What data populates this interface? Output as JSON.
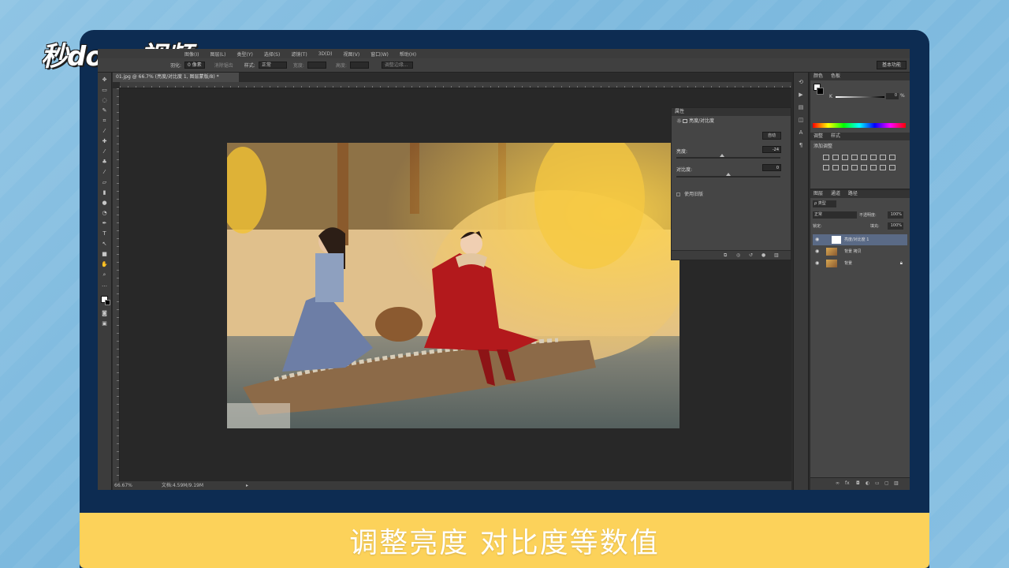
{
  "logo": {
    "text": "秒dong视频"
  },
  "caption": {
    "text": "调整亮度 对比度等数值"
  },
  "menubar": {
    "items": [
      "图像(I)",
      "图层(L)",
      "类型(Y)",
      "选择(S)",
      "滤镜(T)",
      "3D(D)",
      "视图(V)",
      "窗口(W)",
      "帮助(H)"
    ]
  },
  "optionsbar": {
    "feather_label": "羽化:",
    "feather_value": "0 像素",
    "antialias_label": "消除锯齿",
    "style_label": "样式:",
    "style_value": "正常",
    "width_label": "宽度:",
    "height_label": "高度:",
    "refine_label": "调整边缘...",
    "workspace_label": "基本功能"
  },
  "document": {
    "tab_label": "01.jpg @ 66.7% (亮度/对比度 1, 图层蒙版/8) *",
    "zoom": "66.67%",
    "doc_info": "文档:4.59M/9.19M"
  },
  "properties": {
    "header": "属性",
    "title": "亮度/对比度",
    "auto_label": "自动",
    "brightness_label": "亮度:",
    "brightness_value": "-24",
    "contrast_label": "对比度:",
    "contrast_value": "0",
    "legacy_label": "使用旧版"
  },
  "color_panel": {
    "tabs": [
      "颜色",
      "色板"
    ],
    "k_label": "K",
    "k_value": "0",
    "percent": "%"
  },
  "adjust_panel": {
    "tabs": [
      "调整",
      "样式"
    ],
    "add_label": "添加调整"
  },
  "layers_panel": {
    "tabs": [
      "图层",
      "通道",
      "路径"
    ],
    "kind_label": "ρ 类型",
    "blend_mode": "正常",
    "opacity_label": "不透明度:",
    "opacity_value": "100%",
    "lock_label": "锁定:",
    "fill_label": "填充:",
    "fill_value": "100%",
    "layers": [
      {
        "name": "亮度/对比度 1",
        "selected": true
      },
      {
        "name": "背景 拷贝",
        "selected": false
      },
      {
        "name": "背景",
        "selected": false,
        "locked": true
      }
    ]
  }
}
